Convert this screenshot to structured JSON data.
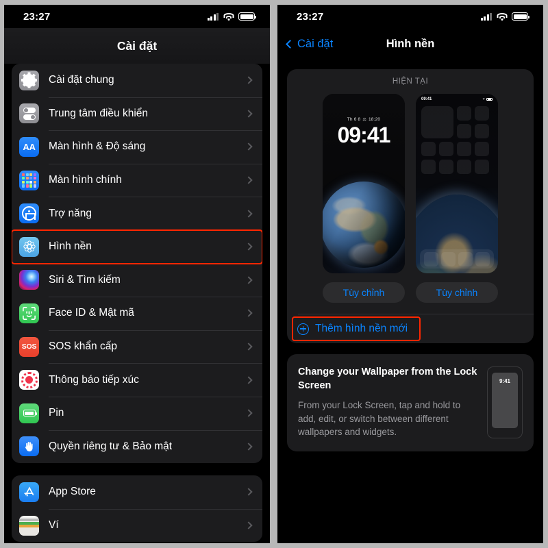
{
  "colors": {
    "accent_blue": "#0a84ff",
    "highlight_red": "#ff2600",
    "card_bg": "#1c1c1e",
    "panel_bg": "#000000",
    "secondary_text": "#8e8e93"
  },
  "left_panel": {
    "status_bar": {
      "time": "23:27"
    },
    "nav_title": "Cài đặt",
    "groups": [
      {
        "items": [
          {
            "label": "Cài đặt chung",
            "icon": "gear-icon"
          },
          {
            "label": "Trung tâm điều khiển",
            "icon": "control-center-icon"
          },
          {
            "label": "Màn hình & Độ sáng",
            "icon": "display-brightness-icon"
          },
          {
            "label": "Màn hình chính",
            "icon": "home-screen-icon"
          },
          {
            "label": "Trợ năng",
            "icon": "accessibility-icon"
          },
          {
            "label": "Hình nền",
            "icon": "wallpaper-icon",
            "highlighted": true
          },
          {
            "label": "Siri & Tìm kiếm",
            "icon": "siri-icon"
          },
          {
            "label": "Face ID & Mật mã",
            "icon": "face-id-icon"
          },
          {
            "label": "SOS khẩn cấp",
            "icon": "sos-icon"
          },
          {
            "label": "Thông báo tiếp xúc",
            "icon": "exposure-notification-icon"
          },
          {
            "label": "Pin",
            "icon": "battery-icon"
          },
          {
            "label": "Quyền riêng tư & Bảo mật",
            "icon": "privacy-hand-icon"
          }
        ]
      },
      {
        "items": [
          {
            "label": "App Store",
            "icon": "app-store-icon"
          },
          {
            "label": "Ví",
            "icon": "wallet-icon"
          }
        ]
      }
    ]
  },
  "right_panel": {
    "status_bar": {
      "time": "23:27"
    },
    "nav": {
      "back_label": "Cài đặt",
      "title": "Hình nền"
    },
    "current_card": {
      "header": "HIỆN TẠI",
      "lock_preview": {
        "date": "Th 6 8",
        "date_secondary": "18:20",
        "time": "09:41",
        "customize_label": "Tùy chỉnh"
      },
      "home_preview": {
        "status_time": "09:41",
        "customize_label": "Tùy chỉnh"
      },
      "add_wallpaper_label": "Thêm hình nền mới",
      "add_wallpaper_highlighted": true
    },
    "info_card": {
      "title": "Change your Wallpaper from the Lock Screen",
      "body": "From your Lock Screen, tap and hold to add, edit, or switch between different wallpapers and widgets.",
      "mini_phone_time": "9:41"
    }
  }
}
